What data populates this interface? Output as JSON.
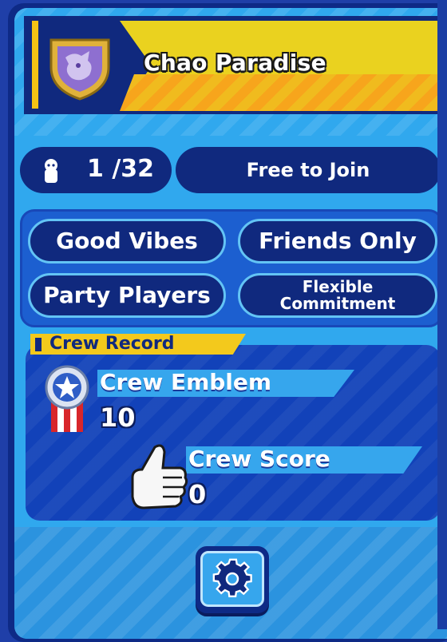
{
  "crew": {
    "name": "Chao Paradise",
    "members": "1 /32",
    "join_policy": "Free to Join",
    "tags": [
      "Good Vibes",
      "Friends Only",
      "Party Players"
    ],
    "tag_multiline": {
      "line1": "Flexible",
      "line2": "Commitment"
    }
  },
  "record": {
    "title": "Crew Record",
    "emblem_label": "Crew Emblem",
    "emblem_value": "10",
    "score_label": "Crew Score",
    "score_value": "0"
  },
  "icons": {
    "crest": "shield-crest-icon",
    "member": "person-icon",
    "emblem": "medal-icon",
    "score": "thumbs-up-icon",
    "settings": "gear-icon"
  },
  "colors": {
    "card": "#30a8ee",
    "navy": "#10297e",
    "banner_yellow": "#ead21f",
    "banner_orange": "#f7a51c",
    "tag_border": "#63c4f5"
  }
}
